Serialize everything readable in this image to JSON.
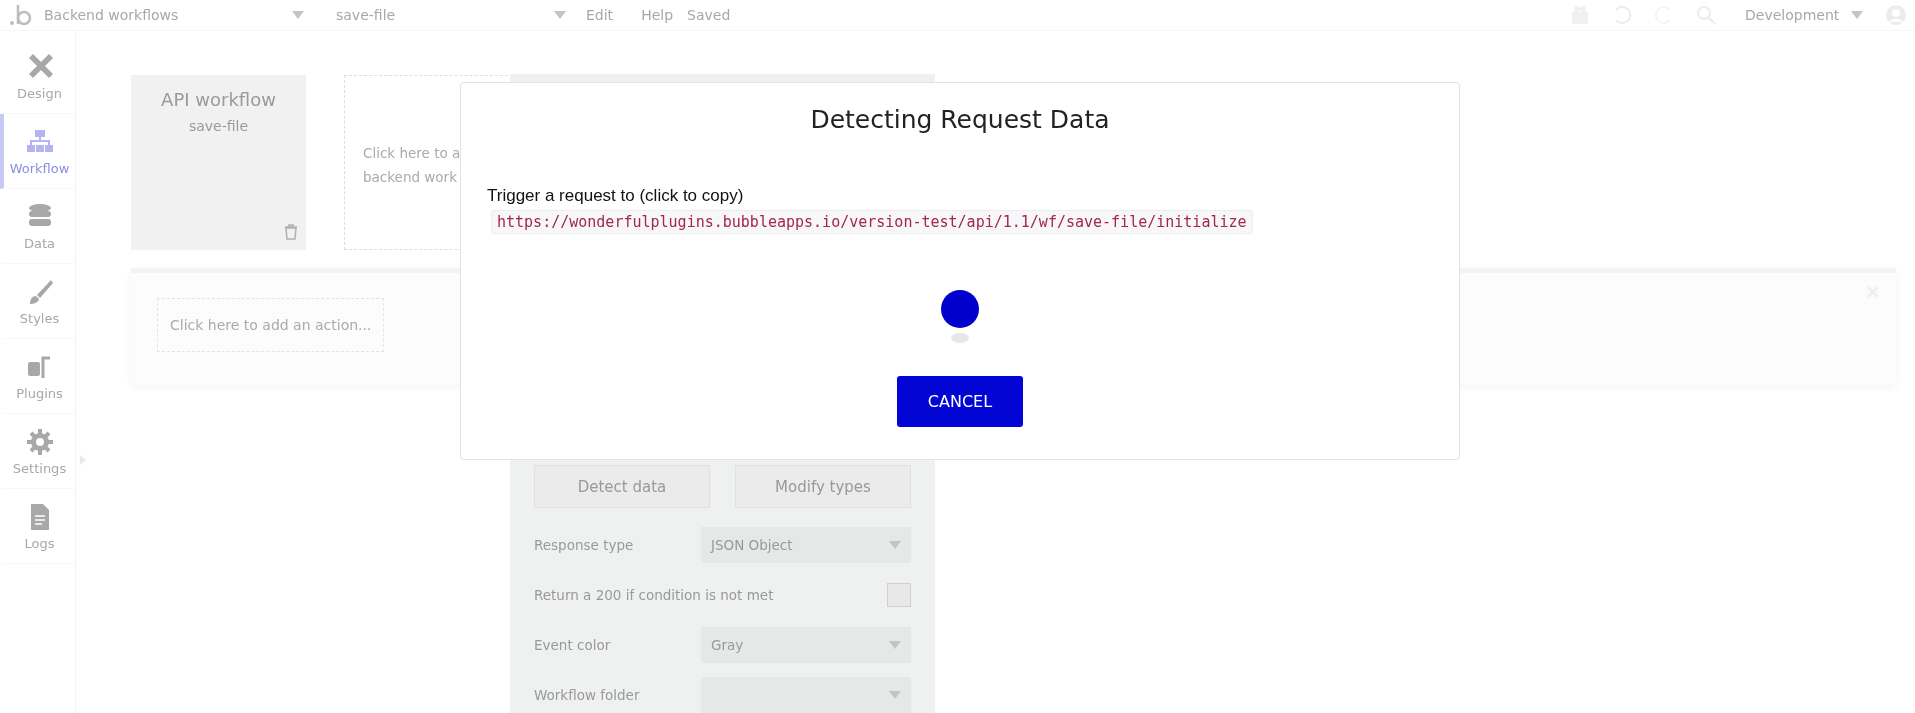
{
  "top_bar": {
    "page": "Backend workflows",
    "workflow": "save-file",
    "menus": [
      "Edit",
      "Help"
    ],
    "status": "Saved",
    "environment": "Development"
  },
  "sidebar": {
    "items": [
      {
        "label": "Design",
        "selected": false
      },
      {
        "label": "Workflow",
        "selected": true
      },
      {
        "label": "Data",
        "selected": false
      },
      {
        "label": "Styles",
        "selected": false
      },
      {
        "label": "Plugins",
        "selected": false
      },
      {
        "label": "Settings",
        "selected": false
      },
      {
        "label": "Logs",
        "selected": false
      }
    ]
  },
  "canvas": {
    "event_card": {
      "title": "API workflow",
      "name": "save-file"
    },
    "add_event_hint": [
      "Click here to a",
      "backend work"
    ],
    "add_action_hint": "Click here to add an action..."
  },
  "property_panel": {
    "buttons": [
      "Detect data",
      "Modify types"
    ],
    "fields": [
      {
        "kind": "dropdown",
        "label": "Response type",
        "value": "JSON Object"
      },
      {
        "kind": "checkbox",
        "label": "Return a 200 if condition is not met",
        "checked": false
      },
      {
        "kind": "dropdown",
        "label": "Event color",
        "value": "Gray"
      },
      {
        "kind": "dropdown",
        "label": "Workflow folder"
      }
    ]
  },
  "modal": {
    "title": "Detecting Request Data",
    "label": "Trigger a request to (click to copy)",
    "url": "https://wonderfulplugins.bubbleapps.io/version-test/api/1.1/wf/save-file/initialize",
    "button": "CANCEL"
  }
}
